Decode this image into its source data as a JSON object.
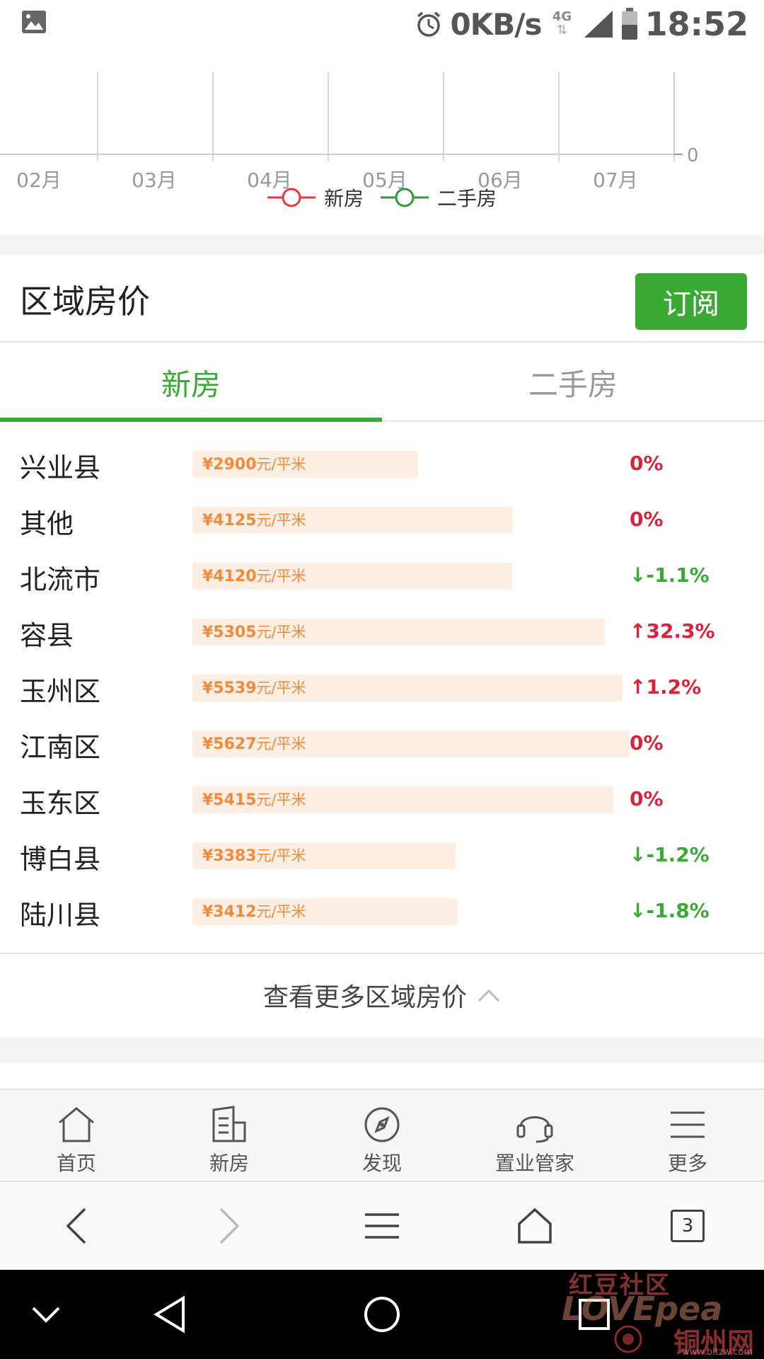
{
  "status_bar": {
    "net_speed": "0KB/s",
    "network": "4G",
    "time": "18:52"
  },
  "chart_data": {
    "type": "line",
    "x": [
      "02月",
      "03月",
      "04月",
      "05月",
      "06月",
      "07月"
    ],
    "y_tick_visible": "0",
    "legend": [
      {
        "name": "新房",
        "color": "#e8363c"
      },
      {
        "name": "二手房",
        "color": "#2a9a3a"
      }
    ],
    "legend_placement": "bottom-center",
    "grid": true
  },
  "section": {
    "title": "区域房价",
    "subscribe_label": "订阅"
  },
  "tabs": [
    {
      "label": "新房",
      "active": true
    },
    {
      "label": "二手房",
      "active": false
    }
  ],
  "price_unit": "元/平米",
  "max_price": 5627,
  "regions": [
    {
      "name": "兴业县",
      "price": "¥2900",
      "value": 2900,
      "change": "0%",
      "trend": "up"
    },
    {
      "name": "其他",
      "price": "¥4125",
      "value": 4125,
      "change": "0%",
      "trend": "up"
    },
    {
      "name": "北流市",
      "price": "¥4120",
      "value": 4120,
      "change": "↓-1.1%",
      "trend": "down"
    },
    {
      "name": "容县",
      "price": "¥5305",
      "value": 5305,
      "change": "↑32.3%",
      "trend": "up"
    },
    {
      "name": "玉州区",
      "price": "¥5539",
      "value": 5539,
      "change": "↑1.2%",
      "trend": "up"
    },
    {
      "name": "江南区",
      "price": "¥5627",
      "value": 5627,
      "change": "0%",
      "trend": "up"
    },
    {
      "name": "玉东区",
      "price": "¥5415",
      "value": 5415,
      "change": "0%",
      "trend": "up"
    },
    {
      "name": "博白县",
      "price": "¥3383",
      "value": 3383,
      "change": "↓-1.2%",
      "trend": "down"
    },
    {
      "name": "陆川县",
      "price": "¥3412",
      "value": 3412,
      "change": "↓-1.8%",
      "trend": "down"
    }
  ],
  "more_link": "查看更多区域房价",
  "app_nav": [
    {
      "label": "首页",
      "icon": "home-icon"
    },
    {
      "label": "新房",
      "icon": "building-icon"
    },
    {
      "label": "发现",
      "icon": "compass-icon"
    },
    {
      "label": "置业管家",
      "icon": "headset-icon"
    },
    {
      "label": "更多",
      "icon": "menu-icon"
    }
  ],
  "browser": {
    "tab_count": "3"
  },
  "watermark": {
    "top": "红豆社区",
    "mid": "LOVEpea",
    "site": "铜州网",
    "url": "www.bltzw.com"
  }
}
